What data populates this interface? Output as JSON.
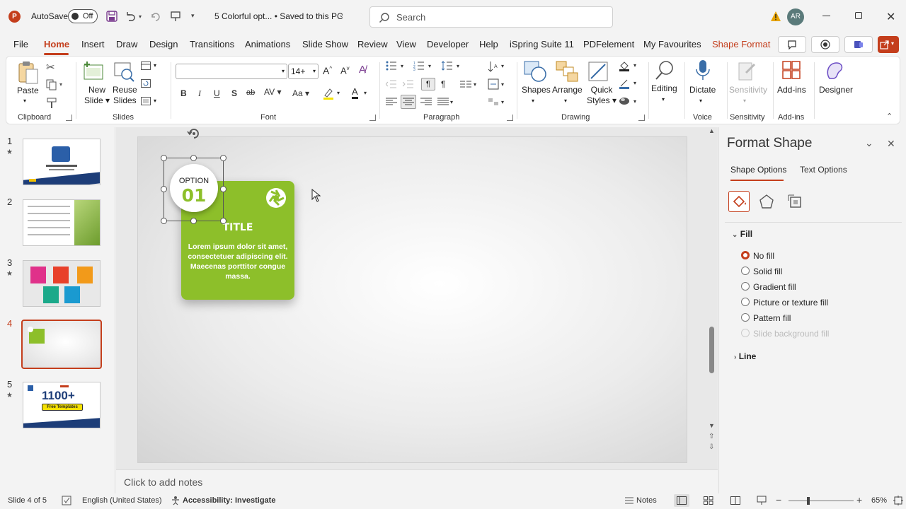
{
  "titlebar": {
    "autosave_label": "AutoSave",
    "autosave_state": "Off",
    "doc_title": "5 Colorful opt... • Saved to this PC",
    "search_placeholder": "Search",
    "avatar": "AR"
  },
  "tabs": [
    "File",
    "Home",
    "Insert",
    "Draw",
    "Design",
    "Transitions",
    "Animations",
    "Slide Show",
    "Review",
    "View",
    "Developer",
    "Help",
    "iSpring Suite 11",
    "PDFelement",
    "My Favourites",
    "Shape Format"
  ],
  "active_tab": "Home",
  "ribbon": {
    "clipboard": {
      "paste": "Paste",
      "label": "Clipboard"
    },
    "slides": {
      "new_slide": "New",
      "new_slide2": "Slide",
      "reuse": "Reuse",
      "reuse2": "Slides",
      "label": "Slides"
    },
    "font": {
      "font_name": "",
      "font_size": "14+",
      "label": "Font"
    },
    "paragraph": {
      "label": "Paragraph"
    },
    "drawing": {
      "shapes": "Shapes",
      "arrange": "Arrange",
      "quick": "Quick",
      "styles": "Styles",
      "label": "Drawing"
    },
    "editing": {
      "label": "Editing"
    },
    "voice": {
      "dictate": "Dictate",
      "label": "Voice"
    },
    "sensitivity": {
      "btn": "Sensitivity",
      "label": "Sensitivity"
    },
    "addins": {
      "btn": "Add-ins",
      "label": "Add-ins"
    },
    "designer": {
      "btn": "Designer"
    }
  },
  "thumbnails": [
    {
      "num": "1",
      "star": "★",
      "big": "",
      "small": ""
    },
    {
      "num": "2",
      "star": "",
      "big": "",
      "small": ""
    },
    {
      "num": "3",
      "star": "★",
      "big": "",
      "small": ""
    },
    {
      "num": "4",
      "star": "",
      "big": "",
      "small": ""
    },
    {
      "num": "5",
      "star": "★",
      "big": "1100+",
      "small": "Free Templates"
    }
  ],
  "selected_slide": 4,
  "slide": {
    "option_label": "OPTION",
    "option_number": "01",
    "card_title": "TITLE",
    "card_body": "Lorem ipsum dolor sit amet, consectetuer adipiscing elit. Maecenas porttitor congue massa.",
    "card_color": "#8dbf2a"
  },
  "notes_placeholder": "Click to add notes",
  "format_pane": {
    "title": "Format Shape",
    "tab_shape": "Shape Options",
    "tab_text": "Text Options",
    "fill_header": "Fill",
    "options": [
      "No fill",
      "Solid fill",
      "Gradient fill",
      "Picture or texture fill",
      "Pattern fill",
      "Slide background fill"
    ],
    "selected_option": "No fill",
    "line_header": "Line",
    "accent": "#c43e1c"
  },
  "status": {
    "slide_info": "Slide 4 of 5",
    "language": "English (United States)",
    "accessibility": "Accessibility: Investigate",
    "notes": "Notes",
    "zoom": "65%"
  }
}
